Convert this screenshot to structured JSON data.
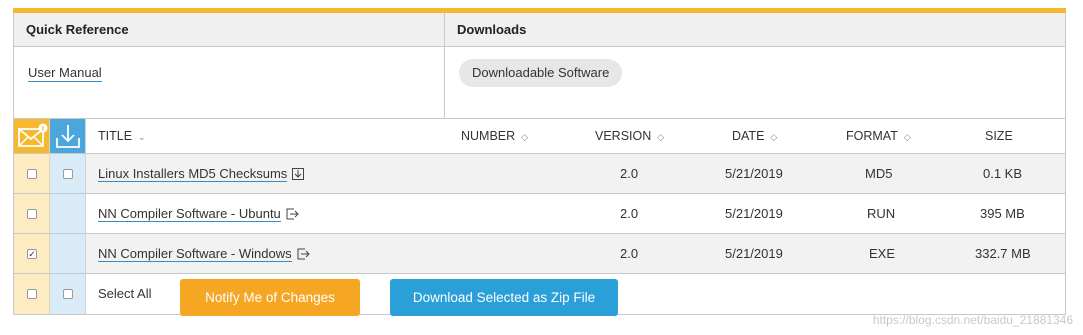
{
  "quick_reference": {
    "heading": "Quick Reference",
    "link": "User Manual"
  },
  "downloads": {
    "heading": "Downloads",
    "pill": "Downloadable Software"
  },
  "table": {
    "headers": {
      "title": "TITLE",
      "number": "NUMBER",
      "version": "VERSION",
      "date": "DATE",
      "format": "FORMAT",
      "size": "SIZE"
    },
    "notify_badge": "!",
    "rows": [
      {
        "title": "Linux Installers MD5 Checksums",
        "version": "2.0",
        "date": "5/21/2019",
        "format": "MD5",
        "size": "0.1 KB",
        "notify_checked": false,
        "download_checked": false,
        "icon": "download-file-icon"
      },
      {
        "title": "NN Compiler Software - Ubuntu",
        "version": "2.0",
        "date": "5/21/2019",
        "format": "RUN",
        "size": "395 MB",
        "notify_checked": false,
        "icon": "external-link-icon"
      },
      {
        "title": "NN Compiler Software - Windows",
        "version": "2.0",
        "date": "5/21/2019",
        "format": "EXE",
        "size": "332.7 MB",
        "notify_checked": true,
        "icon": "external-link-icon"
      }
    ],
    "footer": {
      "select_all": "Select All",
      "notify_button": "Notify Me of Changes",
      "zip_button": "Download Selected as Zip File"
    }
  },
  "colors": {
    "accent": "#f5b82e",
    "notify_button": "#f5a623",
    "download_button": "#2a9fd8",
    "download_column_header": "#4aa6dc"
  },
  "watermark": "https://blog.csdn.net/baidu_21881346"
}
